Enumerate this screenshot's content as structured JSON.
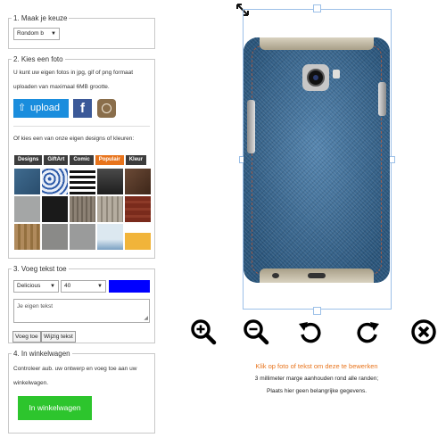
{
  "step1": {
    "legend": "1. Maak je keuze",
    "select_value": "Rondom b"
  },
  "step2": {
    "legend": "2. Kies een foto",
    "intro_line1": "U kunt uw eigen fotos in jpg, gif of png formaat",
    "intro_line2": "uploaden van maximaal 6MB grootte.",
    "upload_label": "upload",
    "designs_text": "Of kies een van onze eigen designs of kleuren:",
    "tabs": [
      "Designs",
      "GiftArt",
      "Comic",
      "Populair",
      "Kleur"
    ],
    "active_tab": "Populair"
  },
  "step3": {
    "legend": "3. Voeg tekst toe",
    "font_value": "Delicious",
    "size_value": "40",
    "color_value": "#0000ff",
    "text_placeholder": "Je eigen tekst",
    "add_button": "Voeg toe",
    "edit_button": "Wijzig tekst"
  },
  "step4": {
    "legend": "4. In winkelwagen",
    "info_line1": "Controleer aub. uw ontwerp en voeg toe aan uw",
    "info_line2": "winkelwagen.",
    "cart_button": "In winkelwagen"
  },
  "canvas": {
    "hint_orange": "Klik op foto of tekst om deze te bewerken",
    "hint_line2": "3 millimeter marge aanhouden rond alle randen;",
    "hint_line3": "Plaats hier geen belangrijke gegevens."
  },
  "colors": {
    "accent_orange": "#e8741c",
    "upload_blue": "#1a8ddd",
    "cart_green": "#2dc52d",
    "denim": "#2f5d84"
  },
  "tools": [
    "zoom-in-icon",
    "zoom-out-icon",
    "rotate-left-icon",
    "rotate-right-icon",
    "delete-icon"
  ]
}
